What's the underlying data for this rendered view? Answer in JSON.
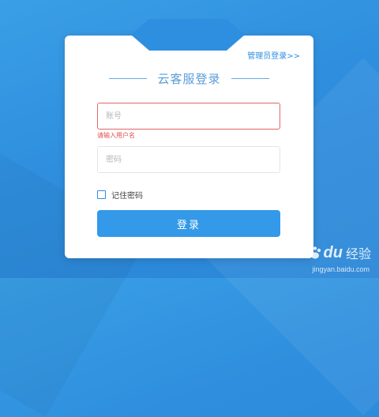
{
  "login": {
    "admin_link": "管理员登录>>",
    "title": "云客服登录",
    "username_placeholder": "账号",
    "username_value": "",
    "username_error": "请输入用户名",
    "password_placeholder": "密码",
    "password_value": "",
    "remember_label": "记住密码",
    "remember_checked": false,
    "submit_label": "登录"
  },
  "watermark": {
    "logo_left": "Bai",
    "logo_right": "du",
    "logo_cn": "经验",
    "url": "jingyan.baidu.com"
  },
  "colors": {
    "background": "#2f8fde",
    "accent": "#3399e8",
    "error": "#e24c4c",
    "title": "#5a9bd8"
  }
}
